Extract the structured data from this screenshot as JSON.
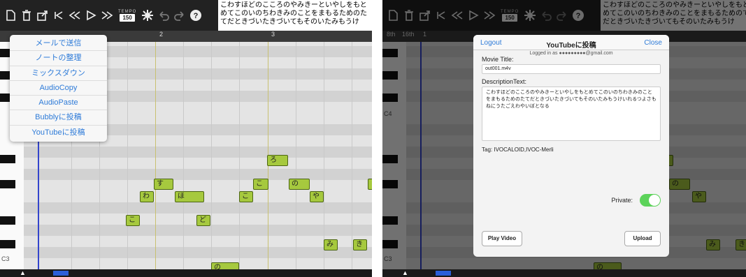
{
  "toolbar": {
    "icons": [
      "new-document-icon",
      "trash-icon",
      "share-icon",
      "skip-to-start-icon",
      "rewind-icon",
      "play-icon",
      "fast-forward-icon",
      "settings-icon",
      "undo-icon",
      "redo-icon",
      "help-icon"
    ],
    "tempo_label": "TEMPO",
    "tempo_value": "150",
    "lyrics": "こわすほどのこころのやみきーといやしをもとめてこのいのちわきみのことをまもるためのたてだときづいたきづいてもそのいたみもうけ",
    "lyrics_right": "こわすほどのこころのやみきーといやしをもとめてこのいのちわきみのことをまもるためのてだときづいたきづいてもそのいたみもうけ"
  },
  "ruler": {
    "marks": [
      "2",
      "3"
    ],
    "right_marks": [
      "8th",
      "16th",
      "1"
    ]
  },
  "keys": {
    "c4": "C4",
    "c3": "C3"
  },
  "menu": {
    "items": [
      "メールで送信",
      "ノートの整理",
      "ミックスダウン",
      "AudioCopy",
      "AudioPaste",
      "Bubblyに投稿",
      "YouTubeに投稿"
    ]
  },
  "notes_left": [
    "ろ",
    "す",
    "こ",
    "の",
    "わ",
    "ほ",
    "こ",
    "や",
    "こ",
    "ど",
    "み",
    "き",
    "の"
  ],
  "notes_right": [
    "の",
    "や",
    "み",
    "き",
    "の"
  ],
  "modal": {
    "logout": "Logout",
    "title": "YouTubeに投稿",
    "close": "Close",
    "logged_in": "Logged in as ●●●●●●●●●@gmail.com",
    "movie_title_label": "Movie Title:",
    "movie_title_value": "out001.m4v",
    "description_label": "DescriptionText:",
    "description_value": "こわすほどのこころのやみきーといやしをもとめてこのいのちわきみのことをまもるためのたてだときづいたきづいてもそのいたみもうけいれるつよさもねにうたごえわやいぼとなる",
    "tag_label": "Tag:",
    "tag_value": "IVOCALOID,IVOC-Merli",
    "private_label": "Private:",
    "private_on": true,
    "play_video": "Play Video",
    "upload": "Upload"
  }
}
